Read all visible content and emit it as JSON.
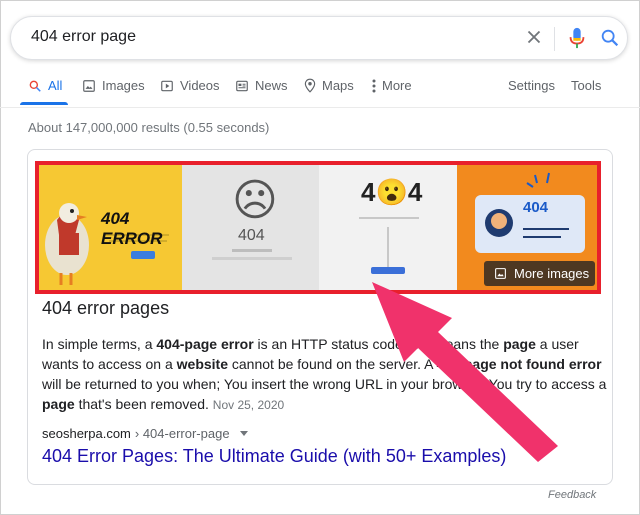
{
  "search": {
    "query": "404 error page"
  },
  "tabs": [
    {
      "label": "All",
      "icon": "search-icon",
      "active": true
    },
    {
      "label": "Images",
      "icon": "image-icon"
    },
    {
      "label": "Videos",
      "icon": "video-icon"
    },
    {
      "label": "News",
      "icon": "news-icon"
    },
    {
      "label": "Maps",
      "icon": "map-pin-icon"
    },
    {
      "label": "More",
      "icon": "more-vert-icon"
    }
  ],
  "tools": {
    "settings": "Settings",
    "tools": "Tools"
  },
  "result_stats": "About 147,000,000 results (0.55 seconds)",
  "image_strip": {
    "tiles": [
      {
        "text": "404 ERROR"
      },
      {
        "text": "404",
        "face": "☹"
      },
      {
        "text": "4😮4"
      },
      {
        "text": "404"
      }
    ],
    "more_images": "More images"
  },
  "featured": {
    "title": "404 error pages",
    "snippet_parts": {
      "p1": "In simple terms, a ",
      "b1": "404-page error",
      "p2": " is an HTTP status code that means the ",
      "b2": "page",
      "p3": " a user wants to access on a ",
      "b3": "website",
      "p4": " cannot be found on the server. A ",
      "b4": "404 page not found error",
      "p5": " will be returned to you when; You insert the wrong URL in your browser. You try to access a ",
      "b5": "page",
      "p6": " that's been removed. "
    },
    "date": "Nov 25, 2020",
    "cite_domain": "seosherpa.com",
    "cite_path": " › 404-error-page",
    "link_title": "404 Error Pages: The Ultimate Guide (with 50+ Examples)"
  },
  "feedback": "Feedback",
  "colors": {
    "accent": "#1a73e8",
    "link": "#1a0dab",
    "highlight": "#e8202c",
    "arrow": "#f0326b"
  }
}
